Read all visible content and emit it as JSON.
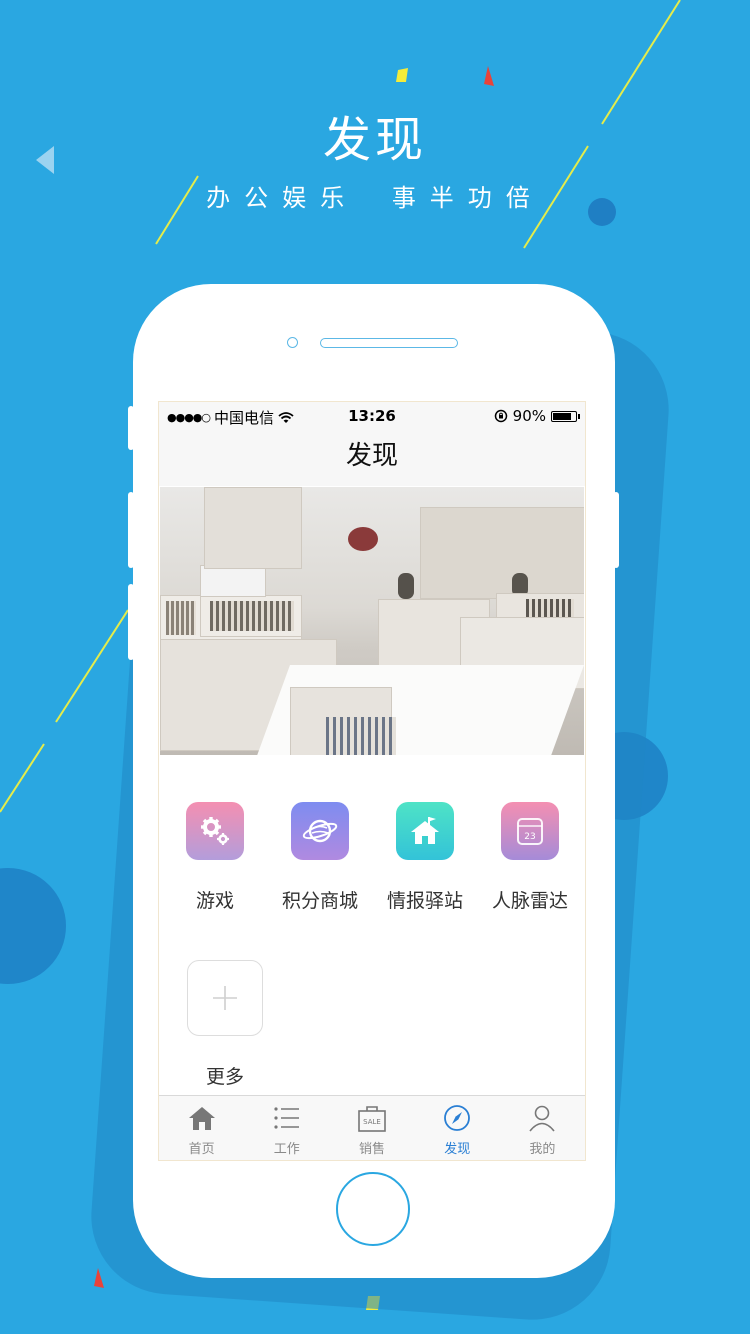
{
  "headline": "发现",
  "tagline": {
    "left": "办公娱乐",
    "right": "事半功倍"
  },
  "status_bar": {
    "signal": "●●●●○",
    "carrier": "中国电信",
    "time": "13:26",
    "battery_text": "90%",
    "battery_level": 0.9
  },
  "nav": {
    "title": "发现"
  },
  "grid": [
    {
      "label": "游戏",
      "icon": "gears-icon",
      "gradient": [
        "#f48fb1",
        "#b39ddb"
      ]
    },
    {
      "label": "积分商城",
      "icon": "planet-icon",
      "gradient": [
        "#7e8cf0",
        "#b08ae0"
      ]
    },
    {
      "label": "情报驿站",
      "icon": "house-flag-icon",
      "gradient": [
        "#4ee3c6",
        "#33c3d8"
      ]
    },
    {
      "label": "人脉雷达",
      "icon": "calendar-icon",
      "gradient": [
        "#f48fb1",
        "#a58bd8"
      ],
      "badge": "23"
    }
  ],
  "more": {
    "label": "更多",
    "icon": "plus-icon"
  },
  "tabs": [
    {
      "label": "首页",
      "icon": "home-icon",
      "active": false
    },
    {
      "label": "工作",
      "icon": "list-icon",
      "active": false
    },
    {
      "label": "销售",
      "icon": "sale-bag-icon",
      "active": false,
      "icon_text": "SALE"
    },
    {
      "label": "发现",
      "icon": "compass-icon",
      "active": true
    },
    {
      "label": "我的",
      "icon": "person-icon",
      "active": false
    }
  ],
  "colors": {
    "background": "#2aa7e1",
    "accent": "#2a7fd4"
  }
}
